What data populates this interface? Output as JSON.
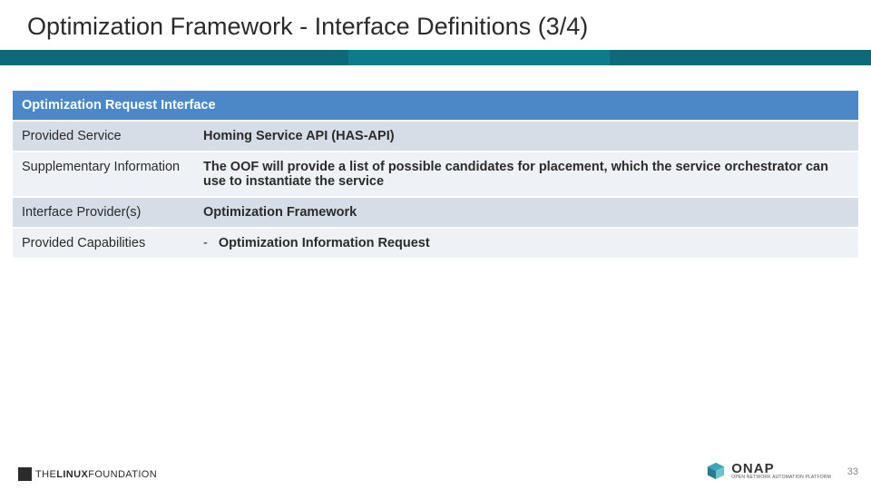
{
  "title": "Optimization Framework - Interface Definitions (3/4)",
  "table": {
    "header": "Optimization Request Interface",
    "rows": [
      {
        "key": "Provided Service",
        "val": "Homing Service API (HAS-API)",
        "bold": true
      },
      {
        "key": "Supplementary Information",
        "val": "The OOF will provide a list of possible candidates for placement, which the service orchestrator can use to instantiate the service",
        "bold": true
      },
      {
        "key": "Interface Provider(s)",
        "val": "Optimization Framework",
        "bold": true
      }
    ],
    "capabilities_key": "Provided Capabilities",
    "capabilities": [
      "Optimization Information Request"
    ]
  },
  "footer": {
    "lf_the": "THE",
    "lf_linux": "LINUX",
    "lf_foundation": "FOUNDATION",
    "onap_name": "ONAP",
    "onap_tag": "OPEN NETWORK AUTOMATION PLATFORM",
    "page": "33"
  }
}
